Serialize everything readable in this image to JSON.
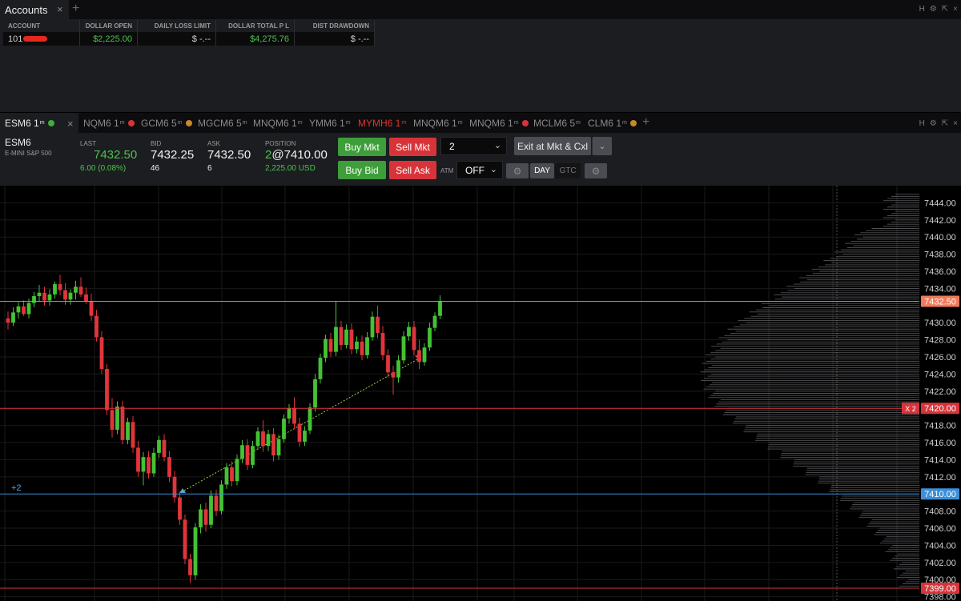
{
  "accounts": {
    "tab_title": "Accounts",
    "close_glyph": "×",
    "add_glyph": "+",
    "window_controls": [
      "H",
      "⚙",
      "⇱",
      "×"
    ],
    "columns": [
      "ACCOUNT",
      "DOLLAR OPEN",
      "DAILY LOSS LIMIT",
      "DOLLAR TOTAL P L",
      "DIST DRAWDOWN"
    ],
    "row": {
      "account": "101",
      "dollar_open": "$2,225.00",
      "daily_loss_limit": "$ -.--",
      "dollar_total_pl": "$4,275.76",
      "dist_drawdown": "$ -.--"
    }
  },
  "chart_tabs": [
    {
      "label": "ESM6 1",
      "sup": "m",
      "dot_color": "#3fae3f",
      "active": true
    },
    {
      "label": "NQM6 1",
      "sup": "m",
      "dot_color": "#d7343a"
    },
    {
      "label": "GCM6 5",
      "sup": "m",
      "dot_color": "#c78a2a"
    },
    {
      "label": "MGCM6 5",
      "sup": "m"
    },
    {
      "label": "MNQM6 1",
      "sup": "m"
    },
    {
      "label": "YMM6 1",
      "sup": "m"
    },
    {
      "label": "MYMH6 1",
      "sup": "m",
      "highlight": true
    },
    {
      "label": "MNQM6 1",
      "sup": "m"
    },
    {
      "label": "MNQM6 1",
      "sup": "m",
      "dot_color": "#d7343a"
    },
    {
      "label": "MCLM6 5",
      "sup": "m"
    },
    {
      "label": "CLM6 1",
      "sup": "m",
      "dot_color": "#c78a2a"
    }
  ],
  "quote": {
    "symbol": "ESM6",
    "description": "E-MINI S&P 500",
    "last_label": "LAST",
    "last": "7432.50",
    "change": "6.00 (0.08%)",
    "bid_label": "BID",
    "bid": "7432.25",
    "bid_size": "46",
    "ask_label": "ASK",
    "ask": "7432.50",
    "ask_size": "6",
    "position_label": "POSITION",
    "position_qty": "2",
    "position_price": "@7410.00",
    "position_pl": "2,225.00 USD"
  },
  "orders": {
    "buy_mkt": "Buy Mkt",
    "sell_mkt": "Sell Mkt",
    "buy_bid": "Buy Bid",
    "sell_ask": "Sell Ask",
    "quantity": "2",
    "exit": "Exit at Mkt & Cxl",
    "atm_label": "ATM",
    "atm_value": "OFF",
    "day": "DAY",
    "gtc": "GTC"
  },
  "colors": {
    "up": "#44c234",
    "down": "#e0353a",
    "position_line": "#3c8fd8",
    "price_line": "#f07a5a",
    "order_line": "#d7343a",
    "low_line": "#d7343a"
  },
  "chart_data": {
    "type": "candlestick",
    "y_ticks": [
      "7444.00",
      "7442.00",
      "7440.00",
      "7438.00",
      "7436.00",
      "7434.00",
      "7430.00",
      "7428.00",
      "7426.00",
      "7424.00",
      "7422.00",
      "7418.00",
      "7416.00",
      "7414.00",
      "7412.00",
      "7408.00",
      "7406.00",
      "7404.00",
      "7402.00",
      "7400.00",
      "7398.00"
    ],
    "y_range": [
      7397.5,
      7446
    ],
    "last_price_label": "7432.50",
    "order_price_label": "7420.00",
    "order_tag": "X  2",
    "position_price_label": "7410.00",
    "position_tag": "+2",
    "low_price_label": "7399.00",
    "ohlc": [
      [
        7430.5,
        7431.3,
        7429.2,
        7430.0
      ],
      [
        7430.0,
        7431.8,
        7429.6,
        7431.2
      ],
      [
        7431.2,
        7432.4,
        7430.5,
        7431.9
      ],
      [
        7431.9,
        7432.6,
        7430.8,
        7431.0
      ],
      [
        7431.0,
        7432.8,
        7430.5,
        7432.3
      ],
      [
        7432.3,
        7433.6,
        7431.8,
        7433.1
      ],
      [
        7433.1,
        7434.4,
        7432.4,
        7433.5
      ],
      [
        7433.5,
        7434.2,
        7432.0,
        7432.6
      ],
      [
        7432.6,
        7433.9,
        7432.0,
        7433.3
      ],
      [
        7433.3,
        7434.8,
        7432.8,
        7434.5
      ],
      [
        7434.5,
        7435.6,
        7433.2,
        7433.8
      ],
      [
        7433.8,
        7434.6,
        7432.1,
        7432.7
      ],
      [
        7432.7,
        7433.9,
        7432.1,
        7433.5
      ],
      [
        7433.5,
        7434.9,
        7432.7,
        7434.2
      ],
      [
        7434.2,
        7435.3,
        7433.0,
        7433.3
      ],
      [
        7433.3,
        7434.1,
        7432.2,
        7432.5
      ],
      [
        7432.5,
        7433.4,
        7430.2,
        7430.8
      ],
      [
        7430.8,
        7431.5,
        7427.8,
        7428.3
      ],
      [
        7428.3,
        7429.0,
        7424.0,
        7424.6
      ],
      [
        7424.6,
        7425.2,
        7419.2,
        7419.8
      ],
      [
        7419.8,
        7421.2,
        7416.6,
        7417.5
      ],
      [
        7417.5,
        7420.8,
        7417.0,
        7420.2
      ],
      [
        7420.2,
        7420.9,
        7415.8,
        7416.3
      ],
      [
        7416.3,
        7418.9,
        7415.8,
        7418.4
      ],
      [
        7418.4,
        7419.1,
        7414.8,
        7415.4
      ],
      [
        7415.4,
        7416.2,
        7412.0,
        7412.6
      ],
      [
        7412.6,
        7414.9,
        7411.0,
        7414.3
      ],
      [
        7414.3,
        7415.0,
        7411.8,
        7412.4
      ],
      [
        7412.4,
        7415.4,
        7412.0,
        7414.8
      ],
      [
        7414.8,
        7416.8,
        7414.2,
        7416.3
      ],
      [
        7416.3,
        7417.0,
        7413.8,
        7414.3
      ],
      [
        7414.3,
        7415.0,
        7411.4,
        7412.0
      ],
      [
        7412.0,
        7412.7,
        7409.0,
        7409.6
      ],
      [
        7409.6,
        7410.3,
        7406.4,
        7407.0
      ],
      [
        7407.0,
        7407.6,
        7401.8,
        7402.4
      ],
      [
        7402.4,
        7403.0,
        7399.6,
        7400.5
      ],
      [
        7400.5,
        7406.6,
        7400.0,
        7406.1
      ],
      [
        7406.1,
        7408.8,
        7405.4,
        7408.2
      ],
      [
        7408.2,
        7409.0,
        7405.6,
        7406.4
      ],
      [
        7406.4,
        7410.4,
        7406.0,
        7409.8
      ],
      [
        7409.8,
        7410.5,
        7407.4,
        7408.0
      ],
      [
        7408.0,
        7411.6,
        7407.6,
        7411.1
      ],
      [
        7411.1,
        7413.6,
        7410.6,
        7413.1
      ],
      [
        7413.1,
        7413.8,
        7410.9,
        7411.5
      ],
      [
        7411.5,
        7414.6,
        7411.0,
        7414.1
      ],
      [
        7414.1,
        7416.3,
        7413.6,
        7415.7
      ],
      [
        7415.7,
        7416.4,
        7412.8,
        7413.4
      ],
      [
        7413.4,
        7416.2,
        7413.0,
        7415.6
      ],
      [
        7415.6,
        7417.8,
        7415.2,
        7417.3
      ],
      [
        7417.3,
        7418.6,
        7414.9,
        7415.6
      ],
      [
        7415.6,
        7417.5,
        7415.0,
        7417.0
      ],
      [
        7417.0,
        7417.7,
        7413.8,
        7414.5
      ],
      [
        7414.5,
        7416.9,
        7414.0,
        7416.4
      ],
      [
        7416.4,
        7419.3,
        7416.0,
        7418.8
      ],
      [
        7418.8,
        7420.5,
        7418.2,
        7420.0
      ],
      [
        7420.0,
        7421.3,
        7417.6,
        7418.2
      ],
      [
        7418.2,
        7418.9,
        7415.5,
        7416.1
      ],
      [
        7416.1,
        7417.9,
        7415.6,
        7417.4
      ],
      [
        7417.4,
        7420.6,
        7417.0,
        7420.1
      ],
      [
        7420.1,
        7424.0,
        7419.6,
        7423.4
      ],
      [
        7423.4,
        7426.4,
        7422.9,
        7425.9
      ],
      [
        7425.9,
        7428.6,
        7425.4,
        7428.1
      ],
      [
        7428.1,
        7428.8,
        7426.0,
        7426.6
      ],
      [
        7426.6,
        7432.5,
        7426.1,
        7429.5
      ],
      [
        7429.5,
        7430.2,
        7426.8,
        7427.4
      ],
      [
        7427.4,
        7429.8,
        7427.0,
        7429.2
      ],
      [
        7429.2,
        7429.9,
        7426.3,
        7426.9
      ],
      [
        7426.9,
        7428.4,
        7426.4,
        7427.8
      ],
      [
        7427.8,
        7428.5,
        7425.6,
        7426.2
      ],
      [
        7426.2,
        7428.9,
        7425.8,
        7428.3
      ],
      [
        7428.3,
        7431.3,
        7427.9,
        7430.7
      ],
      [
        7430.7,
        7432.0,
        7428.2,
        7428.8
      ],
      [
        7428.8,
        7429.6,
        7425.6,
        7426.2
      ],
      [
        7426.2,
        7426.9,
        7423.6,
        7424.2
      ],
      [
        7424.2,
        7425.0,
        7421.6,
        7423.6
      ],
      [
        7423.6,
        7426.2,
        7423.0,
        7425.6
      ],
      [
        7425.6,
        7429.0,
        7425.2,
        7428.4
      ],
      [
        7428.4,
        7430.1,
        7427.9,
        7429.5
      ],
      [
        7429.5,
        7430.2,
        7426.2,
        7426.8
      ],
      [
        7426.8,
        7428.0,
        7424.6,
        7425.4
      ],
      [
        7425.4,
        7427.6,
        7425.0,
        7427.1
      ],
      [
        7427.1,
        7430.0,
        7426.7,
        7429.4
      ],
      [
        7429.4,
        7431.2,
        7429.0,
        7430.8
      ],
      [
        7430.8,
        7433.2,
        7430.4,
        7432.5
      ]
    ],
    "volume_profile_note": "horizontal volume-at-price histogram on right"
  }
}
